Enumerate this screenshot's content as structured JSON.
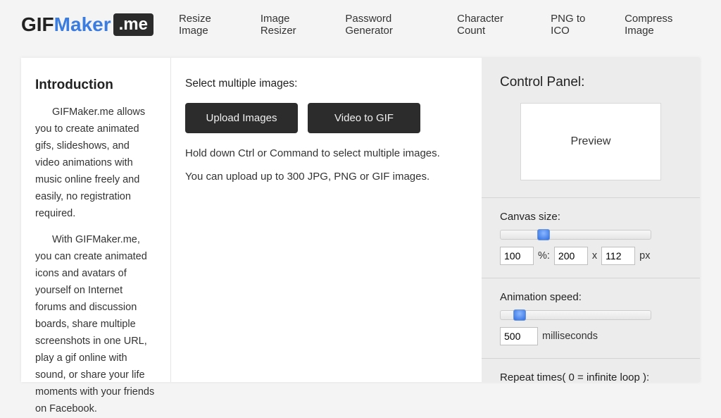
{
  "logo": {
    "part1": "GIF",
    "part2": "Maker",
    "part3": ".me"
  },
  "nav": {
    "items": [
      "Resize Image",
      "Image Resizer",
      "Password Generator",
      "Character Count",
      "PNG to ICO",
      "Compress Image"
    ]
  },
  "intro": {
    "heading": "Introduction",
    "p1": "GIFMaker.me allows you to create animated gifs, slideshows, and video animations with music online freely and easily, no registration required.",
    "p2": "With GIFMaker.me, you can create animated icons and avatars of yourself on Internet forums and discussion boards, share multiple screenshots in one URL, play a gif online with sound, or share your life moments with your friends on Facebook."
  },
  "main": {
    "select_label": "Select multiple images:",
    "upload_btn": "Upload Images",
    "video_btn": "Video to GIF",
    "hint1": "Hold down Ctrl or Command to select multiple images.",
    "hint2": "You can upload up to 300 JPG, PNG or GIF images."
  },
  "panel": {
    "heading": "Control Panel:",
    "preview_label": "Preview",
    "canvas_label": "Canvas size:",
    "canvas_percent": "100",
    "canvas_percent_suffix": "%:",
    "canvas_w": "200",
    "canvas_x": "x",
    "canvas_h": "112",
    "canvas_px": "px",
    "speed_label": "Animation speed:",
    "speed_value": "500",
    "speed_unit": "milliseconds",
    "repeat_label": "Repeat times( 0 = infinite loop ):",
    "slider_canvas_pos": "52px",
    "slider_speed_pos": "18px"
  }
}
